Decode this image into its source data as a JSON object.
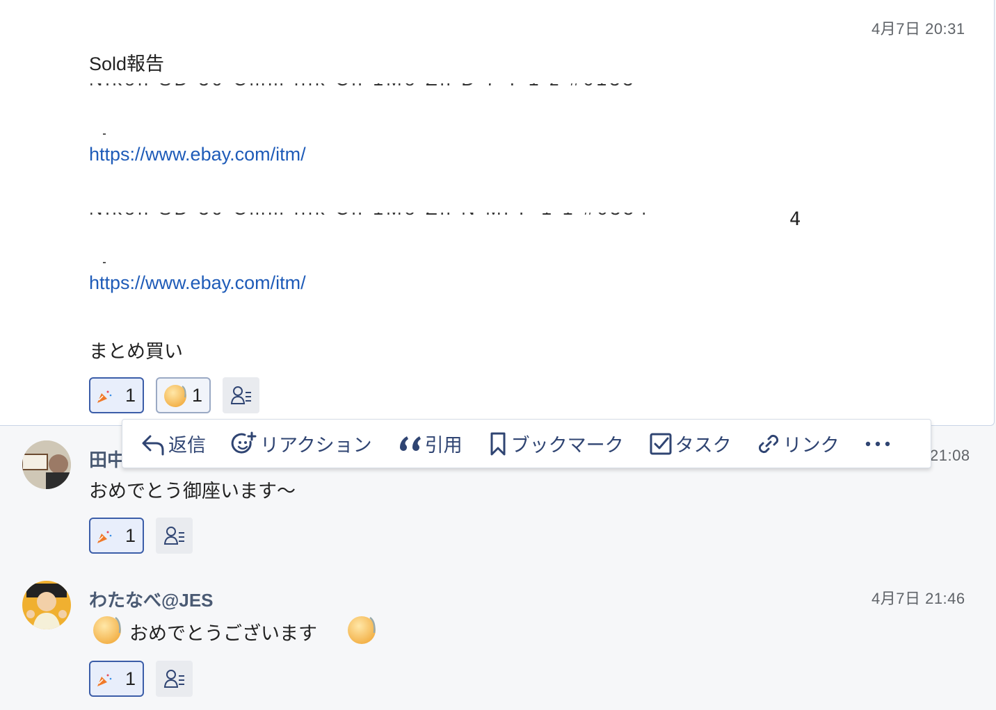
{
  "messages": [
    {
      "timestamp": "4月7日 20:31",
      "title": "Sold報告",
      "link1": "https://www.ebay.com/itm/",
      "stray_char": "4",
      "link2": "https://www.ebay.com/itm/",
      "footer": "まとめ買い",
      "reactions": [
        {
          "emoji": "party-popper",
          "count": "1"
        },
        {
          "emoji": "smile-face",
          "count": "1"
        }
      ]
    },
    {
      "sender": "田中",
      "timestamp": "21:08",
      "text": "おめでとう御座います〜",
      "reactions": [
        {
          "emoji": "party-popper",
          "count": "1"
        }
      ]
    },
    {
      "sender": "わたなべ@JES",
      "timestamp": "4月7日 21:46",
      "text": "おめでとうございます",
      "reactions": [
        {
          "emoji": "party-popper",
          "count": "1"
        }
      ]
    }
  ],
  "toolbar": {
    "reply": "返信",
    "reaction": "リアクション",
    "quote": "引用",
    "bookmark": "ブックマーク",
    "task": "タスク",
    "link": "リンク"
  },
  "colors": {
    "accent": "#2f4472",
    "link": "#1e5bb8",
    "reaction_border": "#3b5da8"
  }
}
